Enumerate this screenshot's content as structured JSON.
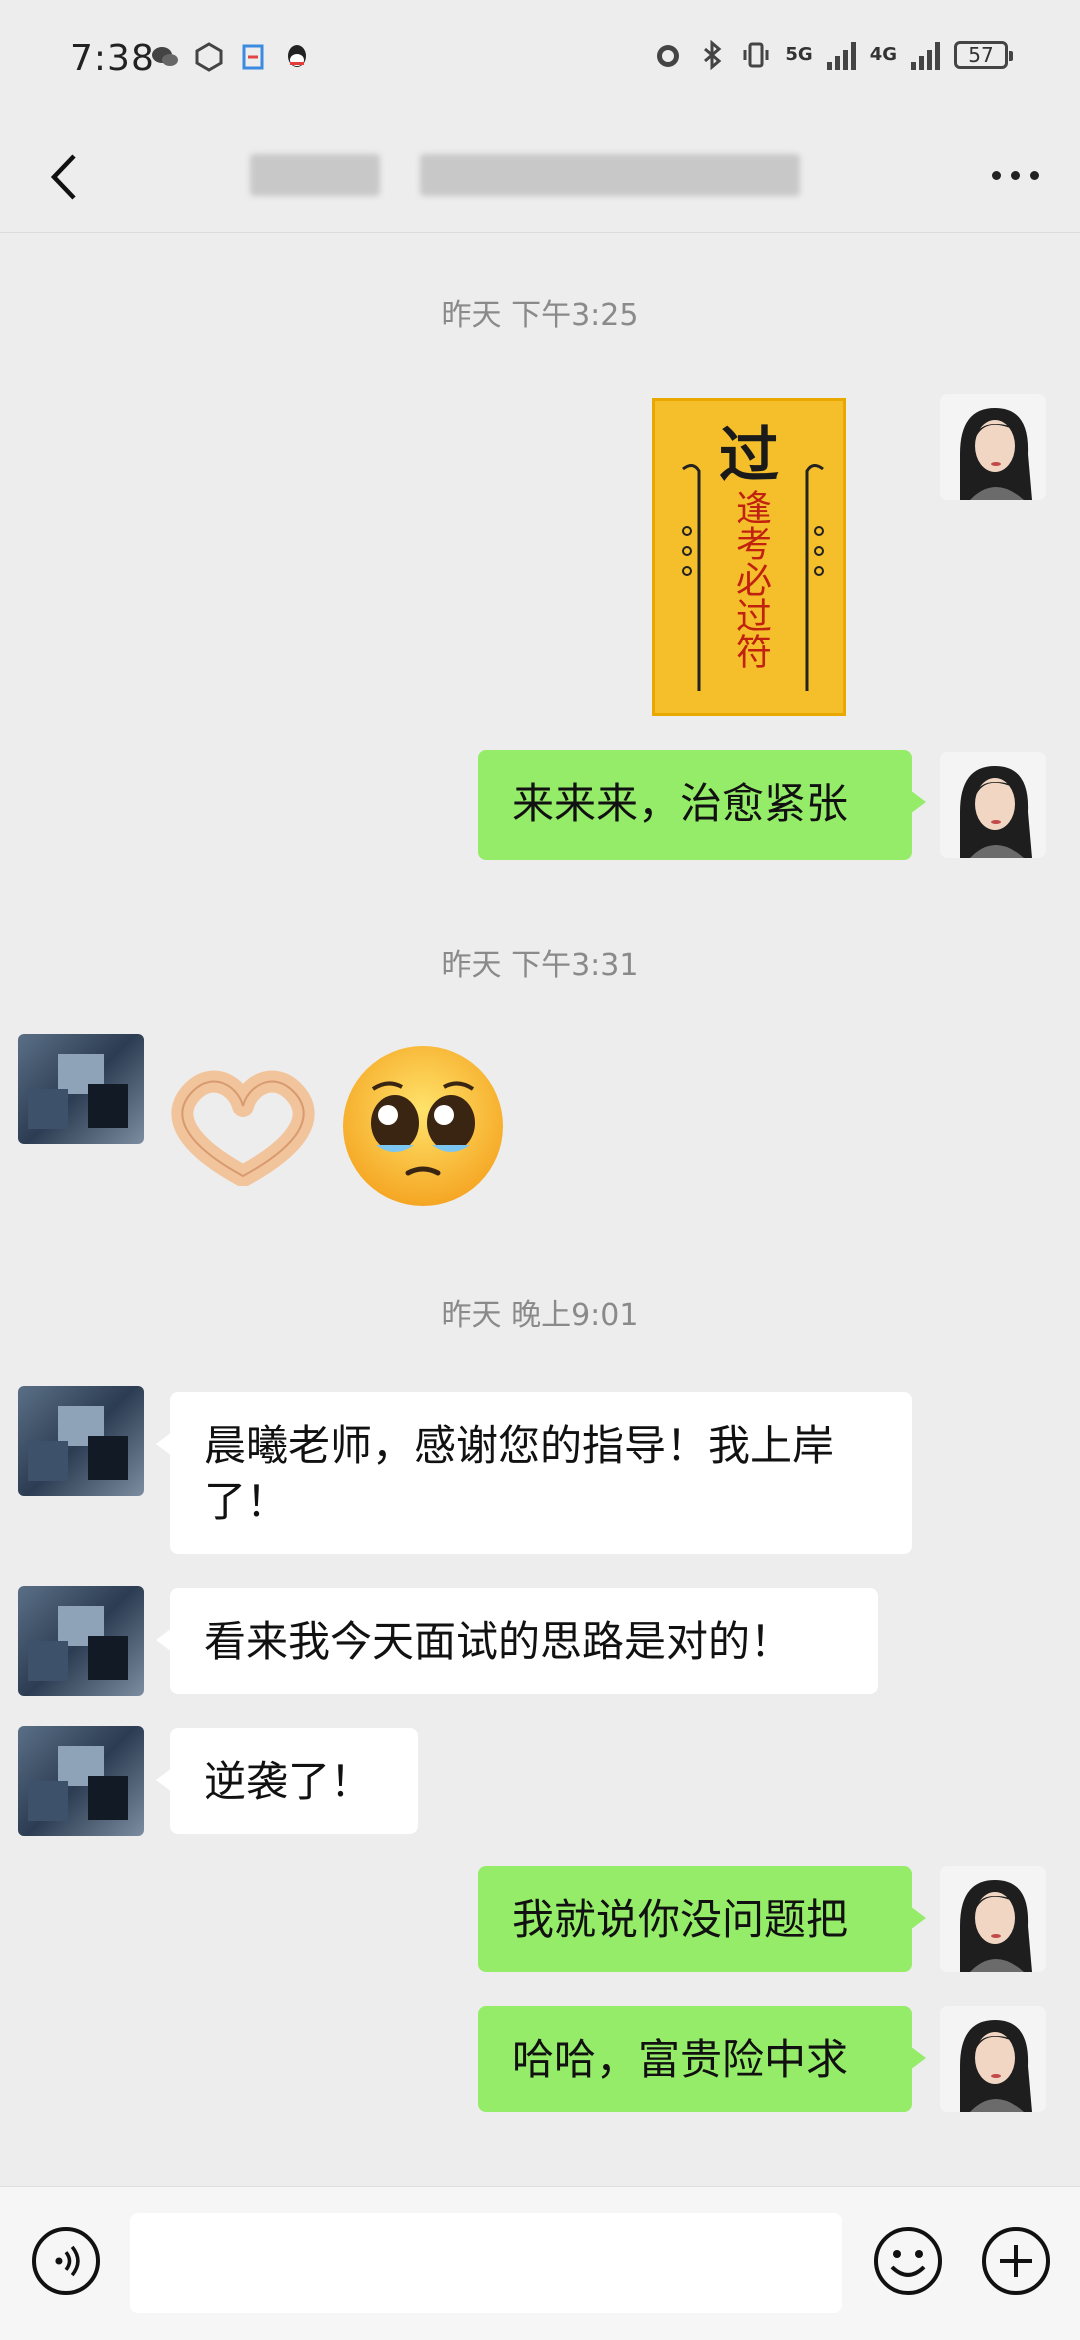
{
  "status_bar": {
    "time": "7:38",
    "network_1": "5G",
    "network_2": "4G",
    "battery": "57"
  },
  "nav": {
    "back_icon": "chevron-left-icon",
    "more_icon": "more-icon"
  },
  "messages": {
    "ts1": "昨天 下午3:25",
    "sticker_title": "过",
    "sticker_text": "逢考必过符",
    "msg1": "来来来，治愈紧张",
    "ts2": "昨天 下午3:31",
    "ts3": "昨天 晚上9:01",
    "msg2": "晨曦老师，感谢您的指导！我上岸了！",
    "msg3": "看来我今天面试的思路是对的！",
    "msg4": "逆袭了！",
    "msg5": "我就说你没问题把",
    "msg6": "哈哈，富贵险中求"
  },
  "input_bar": {
    "value": "",
    "voice_icon": "voice-icon",
    "emoji_icon": "emoji-icon",
    "plus_icon": "plus-icon"
  },
  "colors": {
    "background": "#ededed",
    "my_bubble": "#95ec69",
    "their_bubble": "#ffffff",
    "timestamp": "#8a8a8a"
  }
}
